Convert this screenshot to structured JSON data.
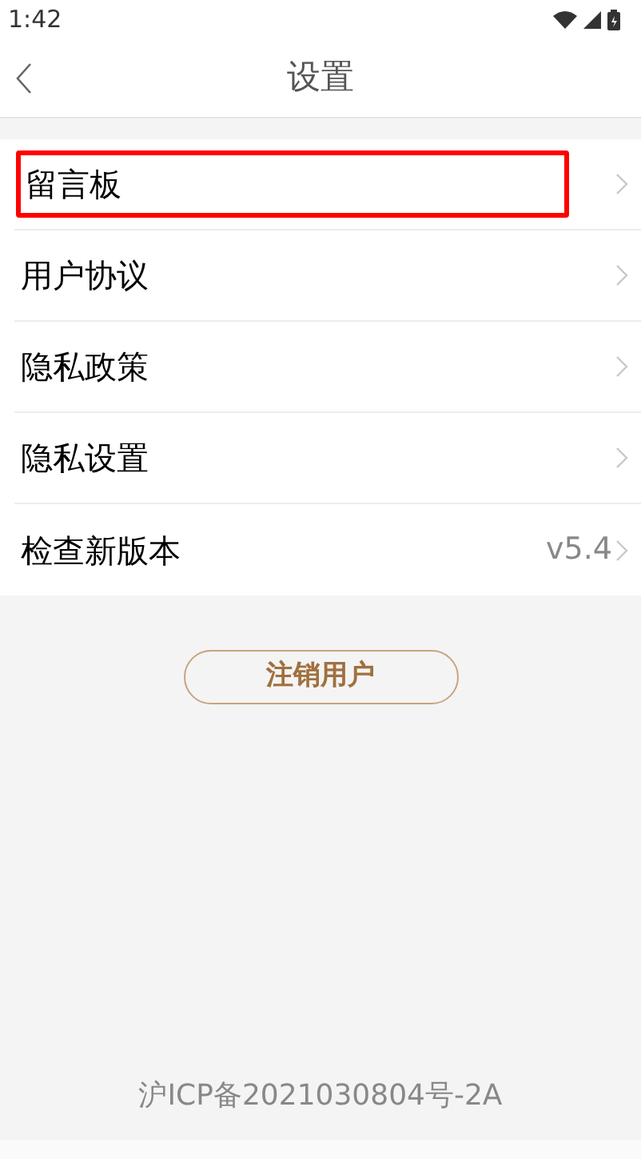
{
  "status_bar": {
    "time": "1:42"
  },
  "header": {
    "title": "设置"
  },
  "items": [
    {
      "label": "留言板",
      "highlighted": true
    },
    {
      "label": "用户协议",
      "highlighted": false
    },
    {
      "label": "隐私政策",
      "highlighted": false
    },
    {
      "label": "隐私设置",
      "highlighted": false
    },
    {
      "label": "检查新版本",
      "value": "v5.4",
      "highlighted": false
    }
  ],
  "logout_button": {
    "label": "注销用户"
  },
  "footer": {
    "text": "沪ICP备2021030804号-2A"
  }
}
